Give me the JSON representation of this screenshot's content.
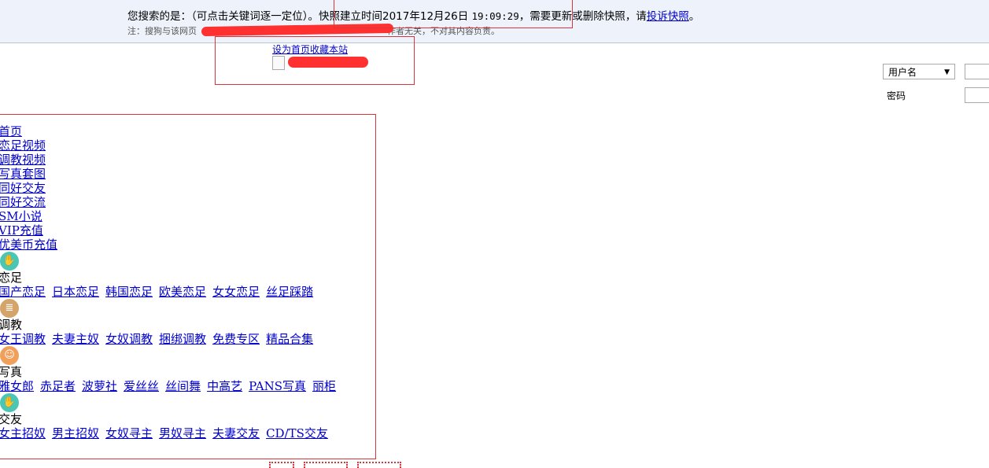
{
  "banner": {
    "search_prefix": "您搜索的是：（可点击关键词逐一定位）。快照建立时间2017年12月26日",
    "time": "19:09:29",
    "search_suffix": "，需要更新或删除快照，请",
    "complaint_link": "投诉快照",
    "period": "。",
    "note_start": "注：搜狗与该网页",
    "note_end": "作者无关，不对其内容负责。"
  },
  "header": {
    "favorite_link": "设为首页收藏本站"
  },
  "login": {
    "username_select": "用户名",
    "password_label": "密码"
  },
  "menu": {
    "items": [
      "首页",
      "恋足视频",
      "调教视频",
      "写真套图",
      "同好交友",
      "同好交流",
      "SM小说",
      "VIP充值",
      "优美币充值"
    ]
  },
  "categories": [
    {
      "icon": "hand-icon",
      "color": "#4cc6b4",
      "glyph": "✋",
      "label": "恋足",
      "links": [
        "国产恋足",
        "日本恋足",
        "韩国恋足",
        "欧美恋足",
        "女女恋足",
        "丝足踩踏"
      ]
    },
    {
      "icon": "notebook-icon",
      "color": "#d4a46a",
      "glyph": "≣",
      "label": "调教",
      "links": [
        "女王调教",
        "夫妻主奴",
        "女奴调教",
        "捆绑调教",
        "免费专区",
        "精品合集"
      ]
    },
    {
      "icon": "face-icon",
      "color": "#f1a05c",
      "glyph": "☺",
      "label": "写真",
      "links": [
        "雅女郎",
        "赤足者",
        "波萝社",
        "爱丝丝",
        "丝间舞",
        "中高艺",
        "PANS写真",
        "丽柜"
      ]
    },
    {
      "icon": "hand-icon",
      "color": "#4cc6b4",
      "glyph": "✋",
      "label": "交友",
      "links": [
        "女主招奴",
        "男主招奴",
        "女奴寻主",
        "男奴寻主",
        "夫妻交友",
        "CD/TS交友"
      ]
    }
  ]
}
